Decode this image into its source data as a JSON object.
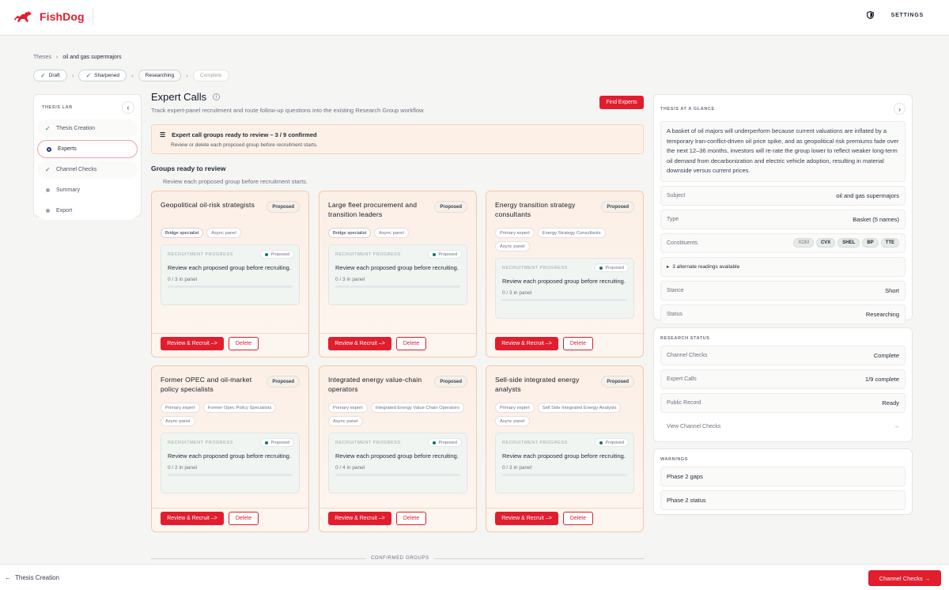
{
  "app": {
    "name": "FishDog",
    "settings_label": "SETTINGS"
  },
  "breadcrumb": {
    "root": "Theses",
    "current": "oil and gas supermajors"
  },
  "steps": [
    {
      "label": "Draft",
      "state": "done"
    },
    {
      "label": "Sharpened",
      "state": "done"
    },
    {
      "label": "Researching",
      "state": "active"
    },
    {
      "label": "Complete",
      "state": "todo"
    }
  ],
  "leftnav": {
    "heading": "THESIS LAB",
    "items": [
      {
        "label": "Thesis Creation",
        "state": "done"
      },
      {
        "label": "Experts",
        "state": "active"
      },
      {
        "label": "Channel Checks",
        "state": "done"
      },
      {
        "label": "Summary",
        "state": "todo"
      },
      {
        "label": "Export",
        "state": "todo"
      }
    ]
  },
  "main": {
    "title": "Expert Calls",
    "subtitle": "Track expert-panel recruitment and route follow-up questions into the existing Research Group workflow.",
    "find_experts_label": "Find Experts",
    "notice_title": "Expert call groups ready to review – 3 / 9 confirmed",
    "notice_sub": "Review or delete each proposed group before recruitment starts.",
    "groups_heading": "Groups ready to review",
    "groups_sub": "Review each proposed group before recruitment starts.",
    "confirmed_label": "CONFIRMED GROUPS"
  },
  "card_common": {
    "badge": "Proposed",
    "progress_label": "RECRUITMENT PROGRESS",
    "progress_pill": "Proposed",
    "progress_text": "Review each proposed group before recruiting.",
    "review_label": "Review & Recruit –>",
    "delete_label": "Delete"
  },
  "cards": [
    {
      "title": "Geopolitical oil-risk strategists",
      "tags": [
        "Bridge specialist",
        "Async panel"
      ],
      "count": "0 / 3 in panel",
      "filled": 0
    },
    {
      "title": "Large fleet procurement and transition leaders",
      "tags": [
        "Bridge specialist",
        "Async panel"
      ],
      "count": "0 / 3 in panel",
      "filled": 0
    },
    {
      "title": "Energy transition strategy consultants",
      "tags": [
        "Primary expert",
        "Energy Strategy Consultants",
        "Async panel"
      ],
      "count": "0 / 3 in panel",
      "filled": 0
    },
    {
      "title": "Former OPEC and oil-market policy specialists",
      "tags": [
        "Primary expert",
        "Former Opec Policy Specialists",
        "Async panel"
      ],
      "count": "0 / 2 in panel",
      "filled": 0
    },
    {
      "title": "Integrated energy value-chain operators",
      "tags": [
        "Primary expert",
        "Integrated Energy Value Chain Operators",
        "Async panel"
      ],
      "count": "0 / 4 in panel",
      "filled": 0
    },
    {
      "title": "Sell-side integrated energy analysts",
      "tags": [
        "Primary expert",
        "Sell Side Integrated Energy Analysts",
        "Async panel"
      ],
      "count": "0 / 3 in panel",
      "filled": 0
    }
  ],
  "glance": {
    "heading": "THESIS AT A GLANCE",
    "thesis": "A basket of oil majors will underperform because current valuations are inflated by a temporary Iran-conflict-driven oil price spike, and as geopolitical risk premiums fade over the next 12–36 months, investors will re-rate the group lower to reflect weaker long-term oil demand from decarbonization and electric vehicle adoption, resulting in material downside versus current prices.",
    "subject_label": "Subject",
    "subject_value": "oil and gas supermajors",
    "type_label": "Type",
    "type_value": "Basket (5 names)",
    "constituents_label": "Constituents",
    "constituents": [
      "XOM",
      "CVX",
      "SHEL",
      "BP",
      "TTE"
    ],
    "alt_readings": "3 alternate readings available",
    "stance_label": "Stance",
    "stance_value": "Short",
    "status_label": "Status",
    "status_value": "Researching"
  },
  "research_status": {
    "heading": "RESEARCH STATUS",
    "rows": [
      {
        "label": "Channel Checks",
        "value": "Complete"
      },
      {
        "label": "Expert Calls",
        "value": "1/9 complete"
      },
      {
        "label": "Public Record",
        "value": "Ready"
      }
    ],
    "link_label": "View Channel Checks",
    "link_arrow": "→"
  },
  "warnings": {
    "heading": "WARNINGS",
    "items": [
      "Phase 2 gaps",
      "Phase 2 status"
    ]
  },
  "footer": {
    "back_label": "Thesis Creation",
    "next_label": "Channel Checks →"
  },
  "colors": {
    "brand": "#e11d2e",
    "done": "#0f766e"
  }
}
